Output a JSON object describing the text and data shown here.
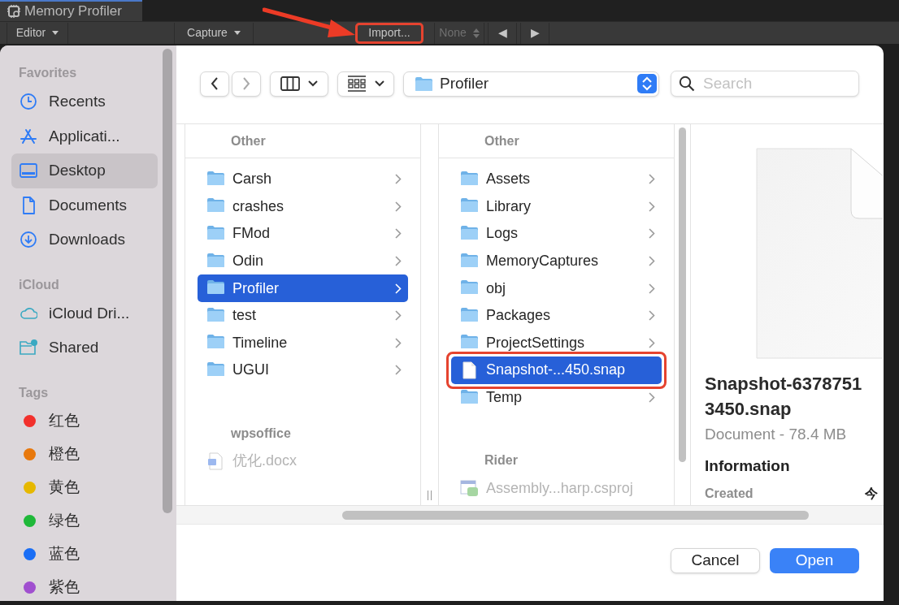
{
  "editor_window": {
    "title": "Memory Profiler"
  },
  "editor_toolbar": [
    {
      "label": "Editor",
      "kind": "dropdown",
      "disabled": false,
      "annotated": false
    },
    {
      "label": "Capture",
      "kind": "dropdown",
      "disabled": false,
      "annotated": false
    },
    {
      "label": "Import...",
      "kind": "button",
      "disabled": false,
      "annotated": true
    },
    {
      "label": "None",
      "kind": "stepper",
      "disabled": true,
      "annotated": false
    },
    {
      "label": "◀",
      "kind": "button",
      "disabled": false,
      "annotated": false
    },
    {
      "label": "▶",
      "kind": "button",
      "disabled": false,
      "annotated": false
    }
  ],
  "sidebar": {
    "sections": [
      {
        "title": "Favorites",
        "items": [
          {
            "label": "Recents",
            "kind": "recents",
            "selected": false
          },
          {
            "label": "Applicati...",
            "kind": "applications",
            "selected": false
          },
          {
            "label": "Desktop",
            "kind": "desktop",
            "selected": true
          },
          {
            "label": "Documents",
            "kind": "documents",
            "selected": false
          },
          {
            "label": "Downloads",
            "kind": "downloads",
            "selected": false
          }
        ]
      },
      {
        "title": "iCloud",
        "items": [
          {
            "label": "iCloud Dri...",
            "kind": "icloud",
            "selected": false
          },
          {
            "label": "Shared",
            "kind": "shared",
            "selected": false
          }
        ]
      },
      {
        "title": "Tags",
        "items": [
          {
            "label": "红色",
            "kind": "tag",
            "color": "#f2302c",
            "selected": false
          },
          {
            "label": "橙色",
            "kind": "tag",
            "color": "#e8780c",
            "selected": false
          },
          {
            "label": "黄色",
            "kind": "tag",
            "color": "#e6b800",
            "selected": false
          },
          {
            "label": "绿色",
            "kind": "tag",
            "color": "#1fb839",
            "selected": false
          },
          {
            "label": "蓝色",
            "kind": "tag",
            "color": "#1a6ef5",
            "selected": false
          },
          {
            "label": "紫色",
            "kind": "tag",
            "color": "#a04fcf",
            "selected": false
          }
        ]
      }
    ]
  },
  "location": {
    "folder": "Profiler"
  },
  "search": {
    "placeholder": "Search"
  },
  "columns": [
    {
      "groups": [
        {
          "title": "Other",
          "items": [
            {
              "name": "Carsh",
              "kind": "folder",
              "selected": false,
              "disabled": false,
              "annotated": false
            },
            {
              "name": "crashes",
              "kind": "folder",
              "selected": false,
              "disabled": false,
              "annotated": false
            },
            {
              "name": "FMod",
              "kind": "folder",
              "selected": false,
              "disabled": false,
              "annotated": false
            },
            {
              "name": "Odin",
              "kind": "folder",
              "selected": false,
              "disabled": false,
              "annotated": false
            },
            {
              "name": "Profiler",
              "kind": "folder",
              "selected": true,
              "disabled": false,
              "annotated": false
            },
            {
              "name": "test",
              "kind": "folder",
              "selected": false,
              "disabled": false,
              "annotated": false
            },
            {
              "name": "Timeline",
              "kind": "folder",
              "selected": false,
              "disabled": false,
              "annotated": false
            },
            {
              "name": "UGUI",
              "kind": "folder",
              "selected": false,
              "disabled": false,
              "annotated": false
            }
          ]
        },
        {
          "title": "wpsoffice",
          "items": [
            {
              "name": "优化.docx",
              "kind": "word",
              "selected": false,
              "disabled": true,
              "annotated": false
            }
          ]
        }
      ]
    },
    {
      "groups": [
        {
          "title": "Other",
          "items": [
            {
              "name": "Assets",
              "kind": "folder",
              "selected": false,
              "disabled": false,
              "annotated": false
            },
            {
              "name": "Library",
              "kind": "folder",
              "selected": false,
              "disabled": false,
              "annotated": false
            },
            {
              "name": "Logs",
              "kind": "folder",
              "selected": false,
              "disabled": false,
              "annotated": false
            },
            {
              "name": "MemoryCaptures",
              "kind": "folder",
              "selected": false,
              "disabled": false,
              "annotated": false
            },
            {
              "name": "obj",
              "kind": "folder",
              "selected": false,
              "disabled": false,
              "annotated": false
            },
            {
              "name": "Packages",
              "kind": "folder",
              "selected": false,
              "disabled": false,
              "annotated": false
            },
            {
              "name": "ProjectSettings",
              "kind": "folder",
              "selected": false,
              "disabled": false,
              "annotated": false
            },
            {
              "name": "Snapshot-...450.snap",
              "kind": "file",
              "selected": true,
              "disabled": false,
              "annotated": true
            },
            {
              "name": "Temp",
              "kind": "folder",
              "selected": false,
              "disabled": false,
              "annotated": false
            }
          ]
        },
        {
          "title": "Rider",
          "items": [
            {
              "name": "Assembly...harp.csproj",
              "kind": "csproj",
              "selected": false,
              "disabled": true,
              "annotated": false
            }
          ]
        }
      ]
    }
  ],
  "preview": {
    "name_lines": [
      "Snapshot-6378751",
      "3450.snap"
    ],
    "subtitle": "Document - 78.4 MB",
    "section": "Information",
    "fields": [
      {
        "label": "Created",
        "value": "今"
      }
    ]
  },
  "buttons": [
    {
      "label": "Cancel",
      "default": false
    },
    {
      "label": "Open",
      "default": true
    }
  ]
}
